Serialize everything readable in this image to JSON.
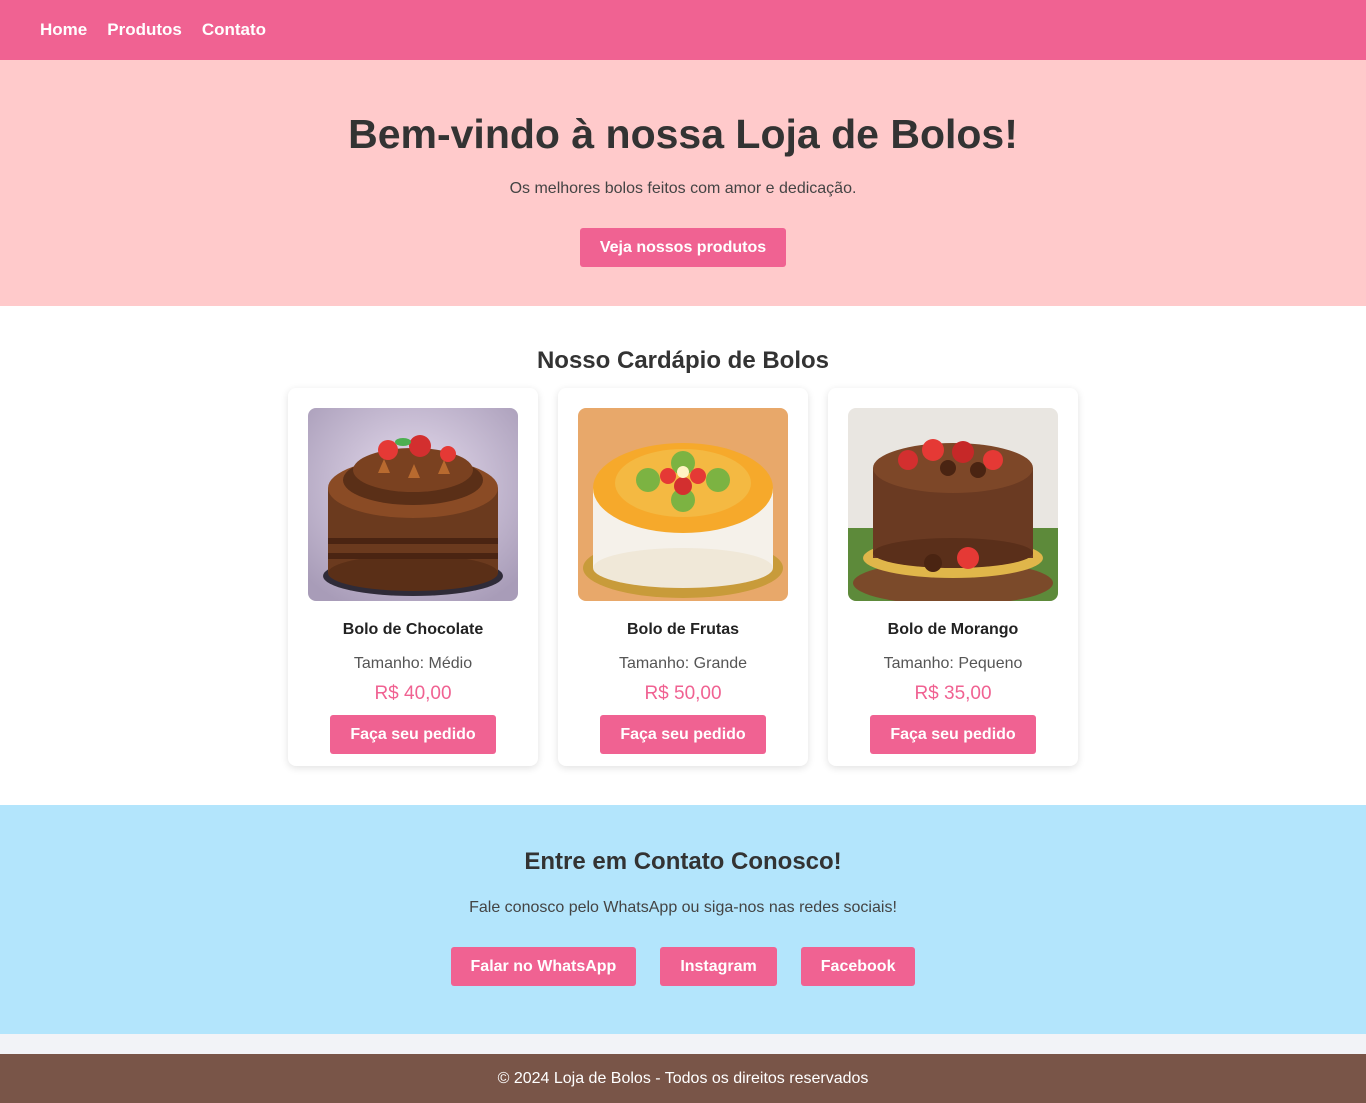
{
  "nav": {
    "items": [
      "Home",
      "Produtos",
      "Contato"
    ]
  },
  "hero": {
    "title": "Bem-vindo à nossa Loja de Bolos!",
    "subtitle": "Os melhores bolos feitos com amor e dedicação.",
    "button": "Veja nossos produtos"
  },
  "menu": {
    "title": "Nosso Cardápio de Bolos",
    "cards": [
      {
        "name": "Bolo de Chocolate",
        "size": "Tamanho: Médio",
        "price": "R$ 40,00",
        "button": "Faça seu pedido",
        "image_icon": "chocolate-cake-image"
      },
      {
        "name": "Bolo de Frutas",
        "size": "Tamanho: Grande",
        "price": "R$ 50,00",
        "button": "Faça seu pedido",
        "image_icon": "fruit-cake-image"
      },
      {
        "name": "Bolo de Morango",
        "size": "Tamanho: Pequeno",
        "price": "R$ 35,00",
        "button": "Faça seu pedido",
        "image_icon": "strawberry-cake-image"
      }
    ]
  },
  "contact": {
    "title": "Entre em Contato Conosco!",
    "text": "Fale conosco pelo WhatsApp ou siga-nos nas redes sociais!",
    "buttons": [
      "Falar no WhatsApp",
      "Instagram",
      "Facebook"
    ]
  },
  "footer": {
    "text": "© 2024 Loja de Bolos - Todos os direitos reservados"
  },
  "colors": {
    "primary": "#f06292",
    "hero_bg": "#ffcacb",
    "contact_bg": "#b3e5fc",
    "footer_bg": "#795548"
  }
}
